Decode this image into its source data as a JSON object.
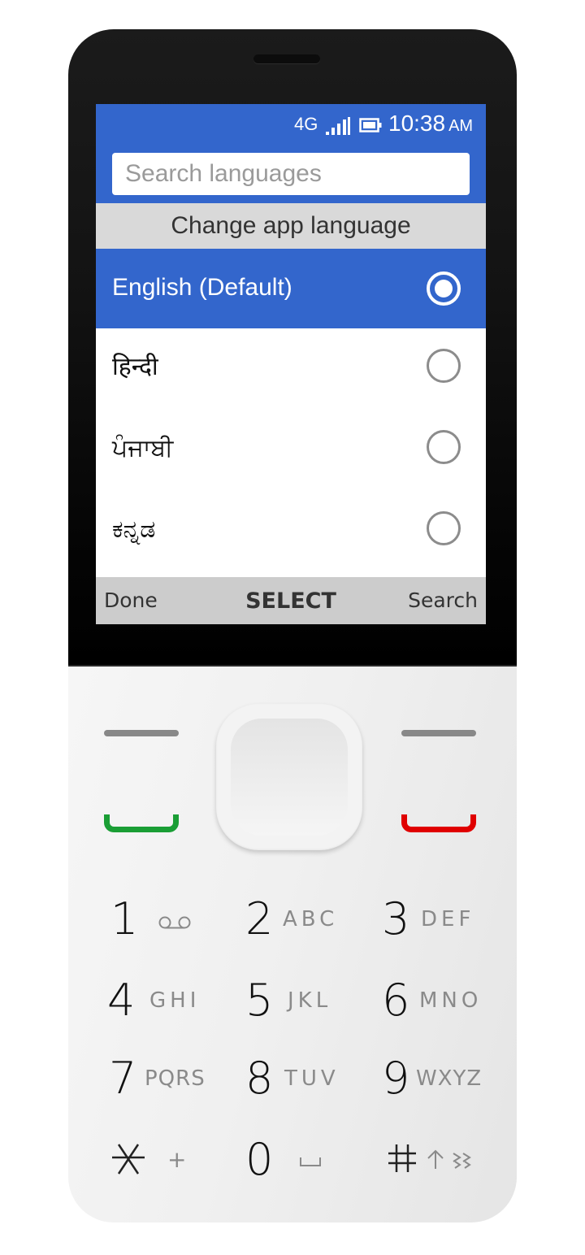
{
  "status_bar": {
    "network": "4G",
    "signal_icon": "signal-bars-icon",
    "battery_icon": "battery-icon",
    "time": "10:38",
    "ampm": "AM"
  },
  "search": {
    "placeholder": "Search languages",
    "value": ""
  },
  "header": {
    "title": "Change app language"
  },
  "languages": [
    {
      "label": "English (Default)",
      "selected": true
    },
    {
      "label": "हिन्दी",
      "selected": false
    },
    {
      "label": "ਪੰਜਾਬੀ",
      "selected": false
    },
    {
      "label": "ಕನ್ನಡ",
      "selected": false
    }
  ],
  "softkeys": {
    "left": "Done",
    "center": "SELECT",
    "right": "Search"
  },
  "colors": {
    "accent": "#3366cc",
    "header_bg": "#d9d9d9",
    "softkey_bg": "#cccccc",
    "call_green": "#1a9e35",
    "end_red": "#e00000"
  },
  "keypad": {
    "keys": [
      {
        "digit": "1",
        "letters": "",
        "glyph": "voicemail-icon"
      },
      {
        "digit": "2",
        "letters": "ABC"
      },
      {
        "digit": "3",
        "letters": "DEF"
      },
      {
        "digit": "4",
        "letters": "GHI"
      },
      {
        "digit": "5",
        "letters": "JKL"
      },
      {
        "digit": "6",
        "letters": "MNO"
      },
      {
        "digit": "7",
        "letters": "PQRS"
      },
      {
        "digit": "8",
        "letters": "TUV"
      },
      {
        "digit": "9",
        "letters": "WXYZ"
      },
      {
        "digit": "✳",
        "letters": "+"
      },
      {
        "digit": "0",
        "letters": "␣"
      },
      {
        "digit": "#",
        "letters": "↑ ⋙"
      }
    ]
  }
}
